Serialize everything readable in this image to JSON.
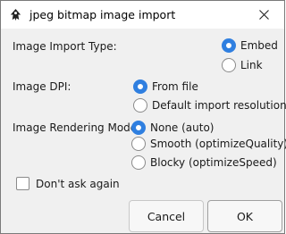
{
  "window": {
    "title": "jpeg bitmap image import"
  },
  "import_type": {
    "label": "Image Import Type:",
    "options": [
      {
        "label": "Embed",
        "checked": true
      },
      {
        "label": "Link",
        "checked": false
      }
    ]
  },
  "dpi": {
    "label": "Image DPI:",
    "options": [
      {
        "label": "From file",
        "checked": true
      },
      {
        "label": "Default import resolution",
        "checked": false
      }
    ]
  },
  "rendering": {
    "label": "Image Rendering Mode:",
    "options": [
      {
        "label": "None (auto)",
        "checked": true
      },
      {
        "label": "Smooth (optimizeQuality)",
        "checked": false
      },
      {
        "label": "Blocky (optimizeSpeed)",
        "checked": false
      }
    ]
  },
  "dont_ask": {
    "label": "Don't ask again",
    "checked": false
  },
  "buttons": {
    "cancel": "Cancel",
    "ok": "OK"
  },
  "colors": {
    "accent": "#2f7fe0",
    "background": "#f0f0f0"
  }
}
